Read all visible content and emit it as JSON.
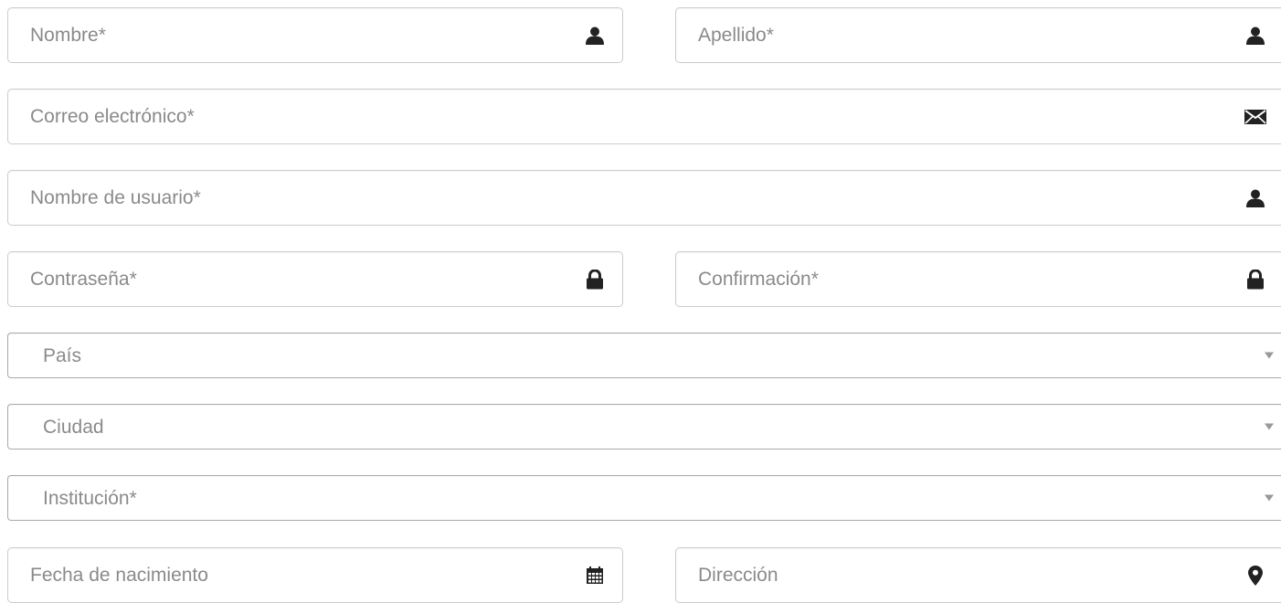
{
  "form": {
    "first_name": {
      "placeholder": "Nombre*",
      "icon": "user-icon"
    },
    "last_name": {
      "placeholder": "Apellido*",
      "icon": "user-icon"
    },
    "email": {
      "placeholder": "Correo electrónico*",
      "icon": "envelope-icon"
    },
    "username": {
      "placeholder": "Nombre de usuario*",
      "icon": "user-icon"
    },
    "password": {
      "placeholder": "Contraseña*",
      "icon": "lock-icon"
    },
    "password_confirm": {
      "placeholder": "Confirmación*",
      "icon": "lock-icon"
    },
    "country": {
      "label": "País",
      "icon": "caret-down-icon"
    },
    "city": {
      "label": "Ciudad",
      "icon": "caret-down-icon"
    },
    "institution": {
      "label": "Institución*",
      "icon": "caret-down-icon"
    },
    "birth_date": {
      "placeholder": "Fecha de nacimiento",
      "icon": "calendar-icon"
    },
    "address": {
      "placeholder": "Dirección",
      "icon": "map-marker-icon"
    }
  },
  "colors": {
    "border": "#cccccc",
    "select_border": "#aaaaaa",
    "placeholder": "#8a8a8a",
    "icon": "#222222"
  }
}
